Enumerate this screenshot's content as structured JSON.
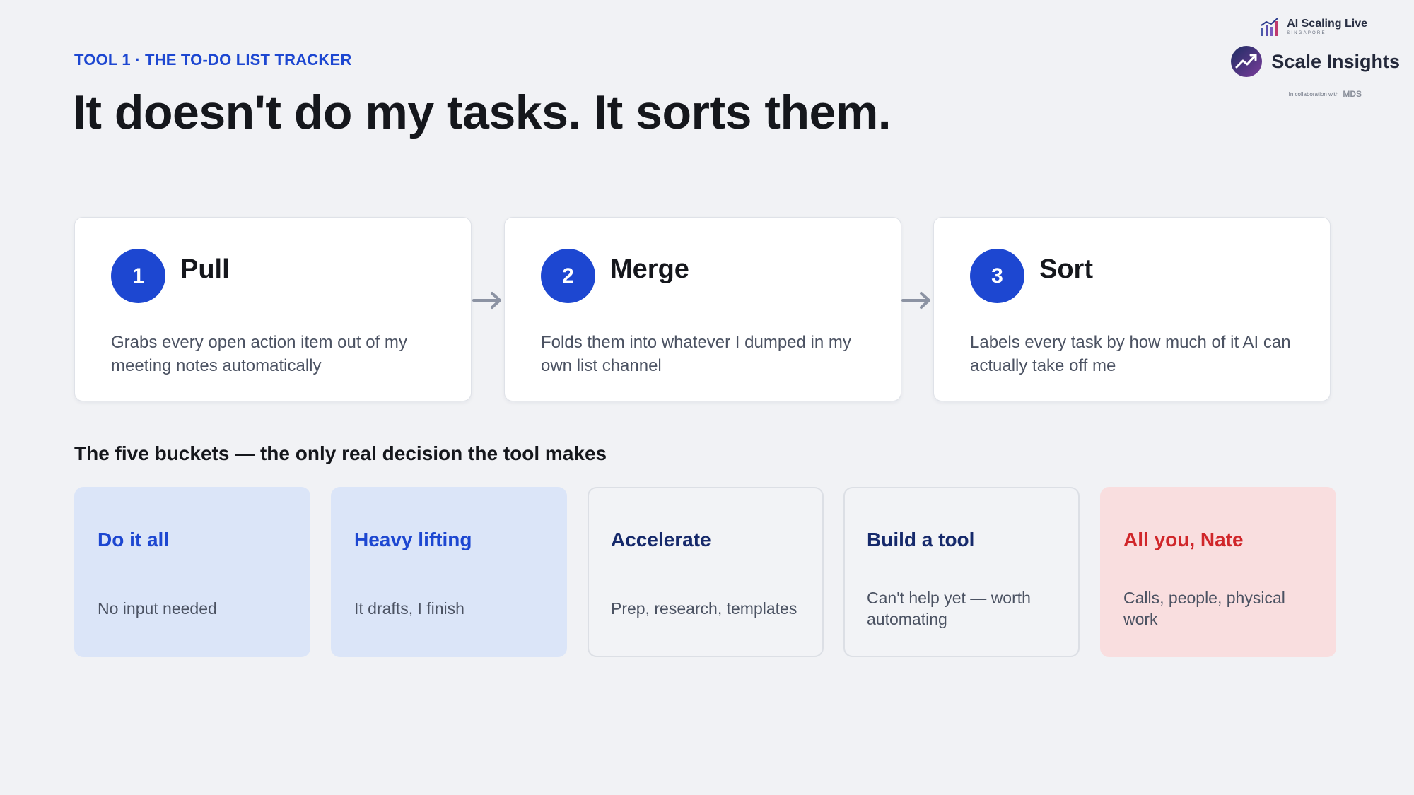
{
  "header": {
    "eyebrow": "TOOL 1 · THE TO-DO LIST TRACKER",
    "headline": "It doesn't do my tasks. It sorts them."
  },
  "logos": {
    "event_title": "AI Scaling Live",
    "event_sub": "SINGAPORE",
    "main_title": "Scale Insights",
    "collab_text": "In collaboration with",
    "collab_brand": "MDS"
  },
  "steps": [
    {
      "number": "1",
      "title": "Pull",
      "description": "Grabs every open action item out of my meeting notes automatically"
    },
    {
      "number": "2",
      "title": "Merge",
      "description": "Folds them into whatever I dumped in my own list channel"
    },
    {
      "number": "3",
      "title": "Sort",
      "description": "Labels every task by how much of it AI can actually take off me"
    }
  ],
  "buckets_heading": "The five buckets — the only real decision the tool makes",
  "buckets": [
    {
      "title": "Do it all",
      "description": "No input needed",
      "title_color": "#1d47d1"
    },
    {
      "title": "Heavy lifting",
      "description": "It drafts, I finish",
      "title_color": "#1d47d1"
    },
    {
      "title": "Accelerate",
      "description": "Prep, research, templates",
      "title_color": "#16296b"
    },
    {
      "title": "Build a tool",
      "description": "Can't help yet — worth automating",
      "title_color": "#16296b"
    },
    {
      "title": "All you, Nate",
      "description": "Calls, people, physical work",
      "title_color": "#d0262a"
    }
  ],
  "colors": {
    "accent": "#1d47d1",
    "background": "#f1f2f5",
    "arrow": "#8c93a3"
  },
  "icons": {
    "event_logo": "bar-chart-icon",
    "main_logo": "trend-up-icon",
    "step_arrow": "arrow-right-icon"
  }
}
